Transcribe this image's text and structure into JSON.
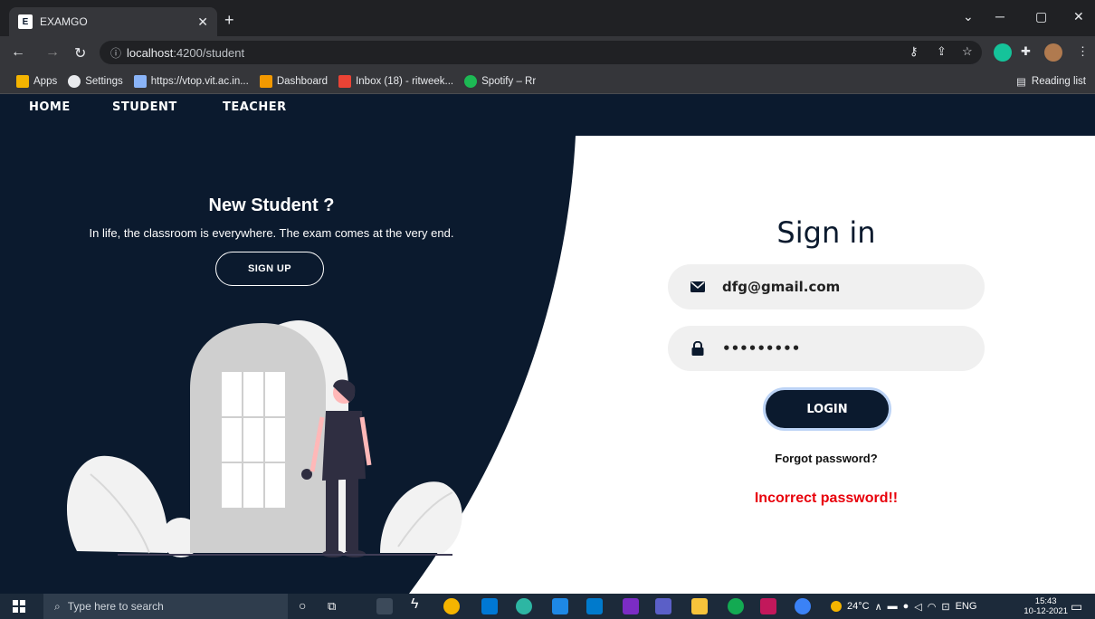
{
  "browser": {
    "tab_title": "EXAMGO",
    "url_host": "localhost",
    "url_path": ":4200/student",
    "bookmarks": [
      {
        "label": "Apps",
        "color": "#f4b400"
      },
      {
        "label": "Settings",
        "color": "#e8eaed"
      },
      {
        "label": "https://vtop.vit.ac.in...",
        "color": "#8ab4f8"
      },
      {
        "label": "Dashboard",
        "color": "#f29900"
      },
      {
        "label": "Inbox (18) - ritweek...",
        "color": "#ea4335"
      },
      {
        "label": "Spotify – Rr",
        "color": "#1db954"
      }
    ],
    "reading_list": "Reading list"
  },
  "nav": {
    "home": "HOME",
    "student": "STUDENT",
    "teacher": "TEACHER"
  },
  "left": {
    "title": "New Student ?",
    "subtitle": "In life, the classroom is everywhere. The exam comes at the very end.",
    "signup_label": "SIGN UP"
  },
  "signin": {
    "title": "Sign in",
    "email_value": "dfg@gmail.com",
    "password_value": "•••••••••",
    "login_label": "LOGIN",
    "forgot_label": "Forgot password?",
    "error_message": "Incorrect password!!"
  },
  "taskbar": {
    "search_placeholder": "Type here to search",
    "weather": "24°C",
    "language": "ENG",
    "time": "15:43",
    "date": "10-12-2021"
  },
  "colors": {
    "navy": "#0b1a2e",
    "error": "#e8000b",
    "field_bg": "#f0f0f0"
  }
}
